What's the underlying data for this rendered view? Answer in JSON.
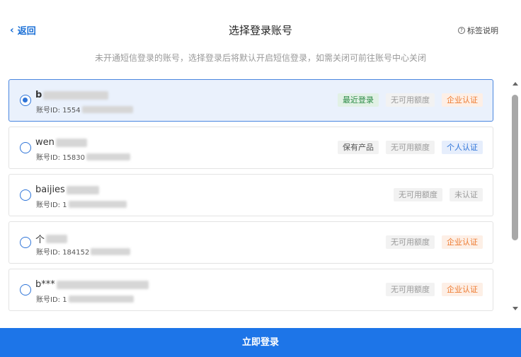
{
  "header": {
    "back_label": "返回",
    "title": "选择登录账号",
    "help_label": "标签说明",
    "subtitle": "未开通短信登录的账号，选择登录后将默认开启短信登录，如需关闭可前往账号中心关闭"
  },
  "accounts": [
    {
      "name": "b",
      "id_prefix": "账号ID: 1554",
      "selected": true,
      "tags": [
        "最近登录",
        "无可用额度",
        "企业认证"
      ]
    },
    {
      "name": "wen",
      "id_prefix": "账号ID: 15830",
      "selected": false,
      "tags": [
        "保有产品",
        "无可用额度",
        "个人认证"
      ]
    },
    {
      "name": "baijies",
      "id_prefix": "账号ID: 1",
      "selected": false,
      "tags": [
        "无可用额度",
        "未认证"
      ]
    },
    {
      "name": "个",
      "id_prefix": "账号ID: 184152",
      "selected": false,
      "tags": [
        "无可用额度",
        "企业认证"
      ]
    },
    {
      "name": "b***",
      "id_prefix": "账号ID: 1",
      "selected": false,
      "tags": [
        "无可用额度",
        "企业认证"
      ]
    }
  ],
  "footer": {
    "login_label": "立即登录"
  },
  "colors": {
    "accent": "#1d75e8",
    "selected_bg": "#eaf1fc",
    "orange": "#ee7a2f",
    "green": "#2a8a44"
  }
}
